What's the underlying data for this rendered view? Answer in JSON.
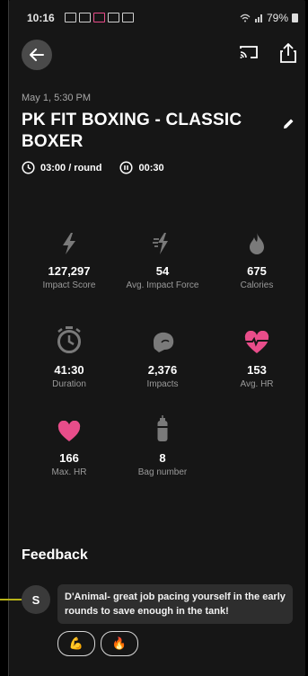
{
  "status_bar": {
    "time": "10:16",
    "battery": "79%"
  },
  "workout": {
    "datetime": "May 1, 5:30 PM",
    "title": "PK FIT BOXING - CLASSIC BOXER",
    "round_time": "03:00 / round",
    "rest_time": "00:30"
  },
  "stats": [
    {
      "icon": "lightning-icon",
      "value": "127,297",
      "label": "Impact Score"
    },
    {
      "icon": "impact-force-icon",
      "value": "54",
      "label": "Avg. Impact Force"
    },
    {
      "icon": "flame-icon",
      "value": "675",
      "label": "Calories"
    },
    {
      "icon": "stopwatch-icon",
      "value": "41:30",
      "label": "Duration"
    },
    {
      "icon": "boxing-glove-icon",
      "value": "2,376",
      "label": "Impacts"
    },
    {
      "icon": "heart-rate-icon",
      "value": "153",
      "label": "Avg. HR"
    },
    {
      "icon": "heart-icon",
      "value": "166",
      "label": "Max. HR"
    },
    {
      "icon": "punching-bag-icon",
      "value": "8",
      "label": "Bag number"
    }
  ],
  "feedback": {
    "title": "Feedback",
    "avatar_initial": "S",
    "comment": "D'Animal- great job pacing yourself in the early rounds to save enough in the tank!",
    "reactions": [
      {
        "icon": "flex-emoji-icon",
        "glyph": "💪"
      },
      {
        "icon": "fire-emoji-icon",
        "glyph": "🔥"
      }
    ]
  },
  "colors": {
    "accent_pink": "#e84d8a",
    "icon_gray": "#7a7a7a",
    "background": "#161616"
  }
}
